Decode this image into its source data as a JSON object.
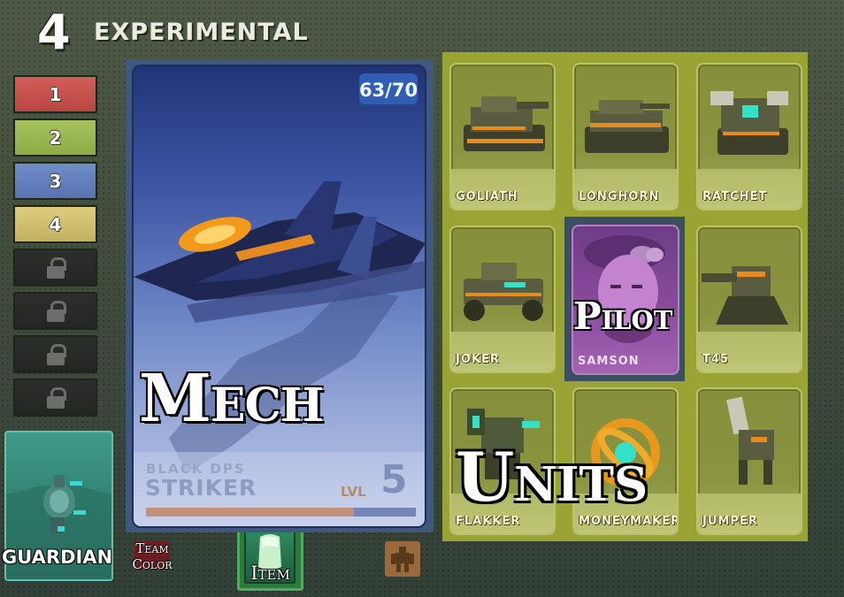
{
  "header": {
    "deck_number": "4",
    "deck_title": "EXPERIMENTAL"
  },
  "deck_slots": [
    {
      "label": "1",
      "state": "red"
    },
    {
      "label": "2",
      "state": "green"
    },
    {
      "label": "3",
      "state": "blue"
    },
    {
      "label": "4",
      "state": "yellow"
    },
    {
      "label": "",
      "state": "locked"
    },
    {
      "label": "",
      "state": "locked"
    },
    {
      "label": "",
      "state": "locked"
    },
    {
      "label": "",
      "state": "locked"
    }
  ],
  "guardian": {
    "label": "GUARDIAN"
  },
  "team_color": {
    "label_line1": "Team",
    "label_line2": "Color",
    "color": "#6a1e24"
  },
  "item": {
    "label": "Item"
  },
  "mech": {
    "count": "63/70",
    "overlay_label": "Mech",
    "class": "BLACK DPS",
    "name": "STRIKER",
    "level_label": "LVL",
    "level": "5",
    "xp_fraction": 0.77
  },
  "units_panel": {
    "overlay_label": "Units",
    "pilot_overlay_label": "Pilot",
    "units": [
      {
        "name": "GOLIATH"
      },
      {
        "name": "LONGHORN"
      },
      {
        "name": "RATCHET"
      },
      {
        "name": "JOKER"
      },
      {
        "name": "SAMSON"
      },
      {
        "name": "T45"
      },
      {
        "name": "FLAKKER"
      },
      {
        "name": "MONEYMAKER"
      },
      {
        "name": "JUMPER"
      }
    ]
  },
  "colors": {
    "unit_panel": "#9aa434",
    "mech_card": "#3c54a3",
    "pilot_card": "#8a4b9d",
    "accent_orange": "#e88a1c"
  }
}
